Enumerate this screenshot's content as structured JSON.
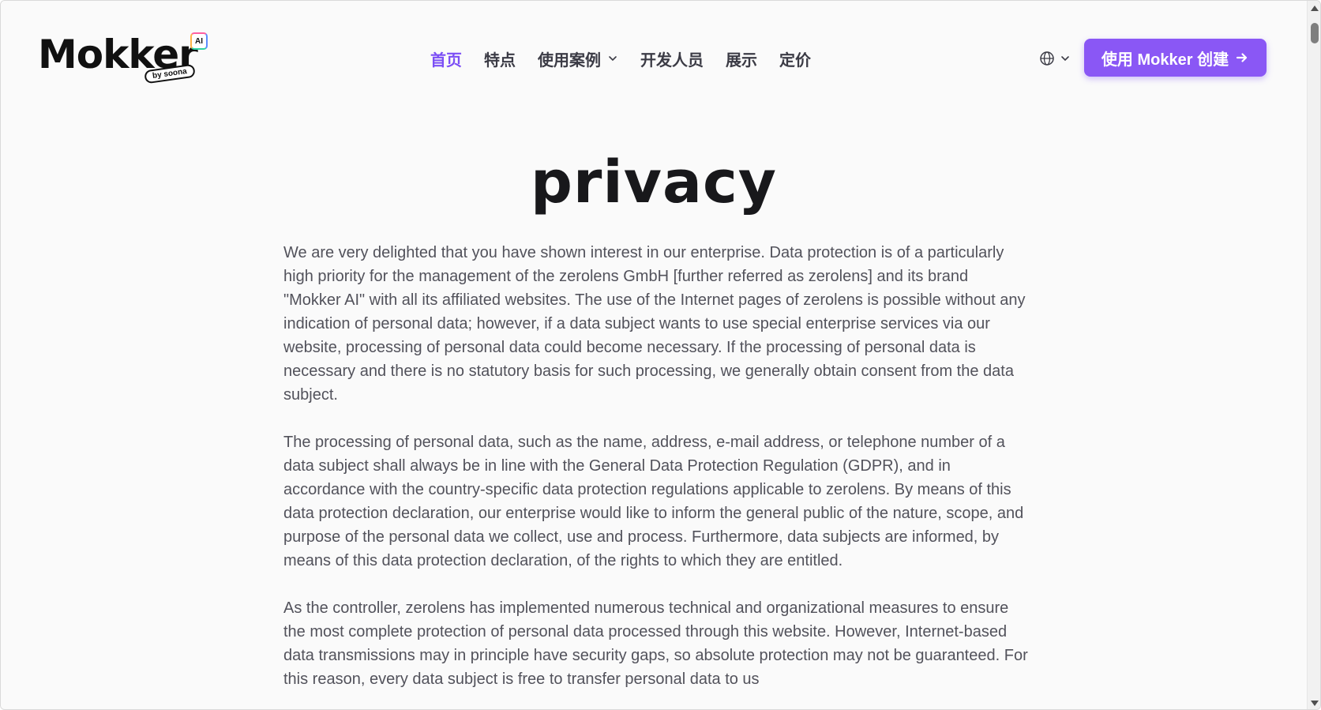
{
  "header": {
    "logo": {
      "name": "Mokker",
      "badge": "AI",
      "tagline": "by soona"
    },
    "nav": [
      {
        "label": "首页",
        "active": true,
        "has_dropdown": false
      },
      {
        "label": "特点",
        "active": false,
        "has_dropdown": false
      },
      {
        "label": "使用案例",
        "active": false,
        "has_dropdown": true
      },
      {
        "label": "开发人员",
        "active": false,
        "has_dropdown": false
      },
      {
        "label": "展示",
        "active": false,
        "has_dropdown": false
      },
      {
        "label": "定价",
        "active": false,
        "has_dropdown": false
      }
    ],
    "language_icon": "globe-icon",
    "cta_label": "使用 Mokker 创建",
    "cta_icon": "arrow-right-icon"
  },
  "main": {
    "title": "privacy",
    "paragraphs": [
      "We are very delighted that you have shown interest in our enterprise. Data protection is of a particularly high priority for the management of the zerolens GmbH [further referred as zerolens] and its brand \"Mokker AI\" with all its affiliated websites. The use of the Internet pages of zerolens is possible without any indication of personal data; however, if a data subject wants to use special enterprise services via our website, processing of personal data could become necessary. If the processing of personal data is necessary and there is no statutory basis for such processing, we generally obtain consent from the data subject.",
      "The processing of personal data, such as the name, address, e-mail address, or telephone number of a data subject shall always be in line with the General Data Protection Regulation (GDPR), and in accordance with the country-specific data protection regulations applicable to zerolens. By means of this data protection declaration, our enterprise would like to inform the general public of the nature, scope, and purpose of the personal data we collect, use and process. Furthermore, data subjects are informed, by means of this data protection declaration, of the rights to which they are entitled.",
      "As the controller, zerolens has implemented numerous technical and organizational measures to ensure the most complete protection of personal data processed through this website. However, Internet-based data transmissions may in principle have security gaps, so absolute protection may not be guaranteed. For this reason, every data subject is free to transfer personal data to us"
    ]
  },
  "colors": {
    "accent": "#7c4ff5",
    "cta_background": "#8a57f5",
    "background": "#fafafa",
    "body_text": "#52525b"
  }
}
